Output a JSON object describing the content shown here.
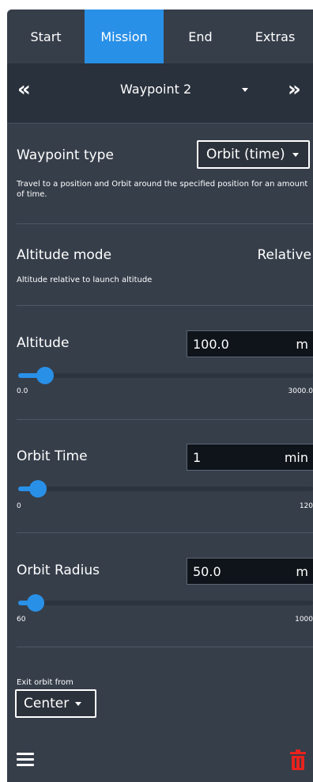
{
  "tabs": [
    {
      "label": "Start"
    },
    {
      "label": "Mission"
    },
    {
      "label": "End"
    },
    {
      "label": "Extras"
    }
  ],
  "active_tab": "Mission",
  "waypoint_nav": {
    "prev_glyph": "«",
    "next_glyph": "»",
    "title": "Waypoint 2"
  },
  "waypoint_type": {
    "label": "Waypoint type",
    "selected": "Orbit (time)",
    "description": "Travel to a position and Orbit around the specified position for an amount of time."
  },
  "altitude_mode": {
    "label": "Altitude mode",
    "value": "Relative",
    "description": "Altitude relative to launch altitude"
  },
  "altitude": {
    "label": "Altitude",
    "value": "100.0",
    "unit": "m",
    "min_label": "0.0",
    "max_label": "3000.0",
    "min": 0,
    "max": 3000,
    "current": 100
  },
  "orbit_time": {
    "label": "Orbit Time",
    "value": "1",
    "unit": "min",
    "min_label": "0",
    "max_label": "120",
    "min": 0,
    "max": 120,
    "current": 1
  },
  "orbit_radius": {
    "label": "Orbit Radius",
    "value": "50.0",
    "unit": "m",
    "min_label": "60",
    "max_label": "1000",
    "min": 60,
    "max": 1000,
    "current": 60
  },
  "exit_orbit": {
    "label": "Exit orbit from",
    "selected": "Center"
  },
  "icons": {
    "menu": "hamburger-menu-icon",
    "delete": "trash-icon"
  },
  "colors": {
    "panel_bg": "#363e4a",
    "nav_bg": "#29313c",
    "accent": "#2990e8",
    "delete": "#e8221d"
  }
}
